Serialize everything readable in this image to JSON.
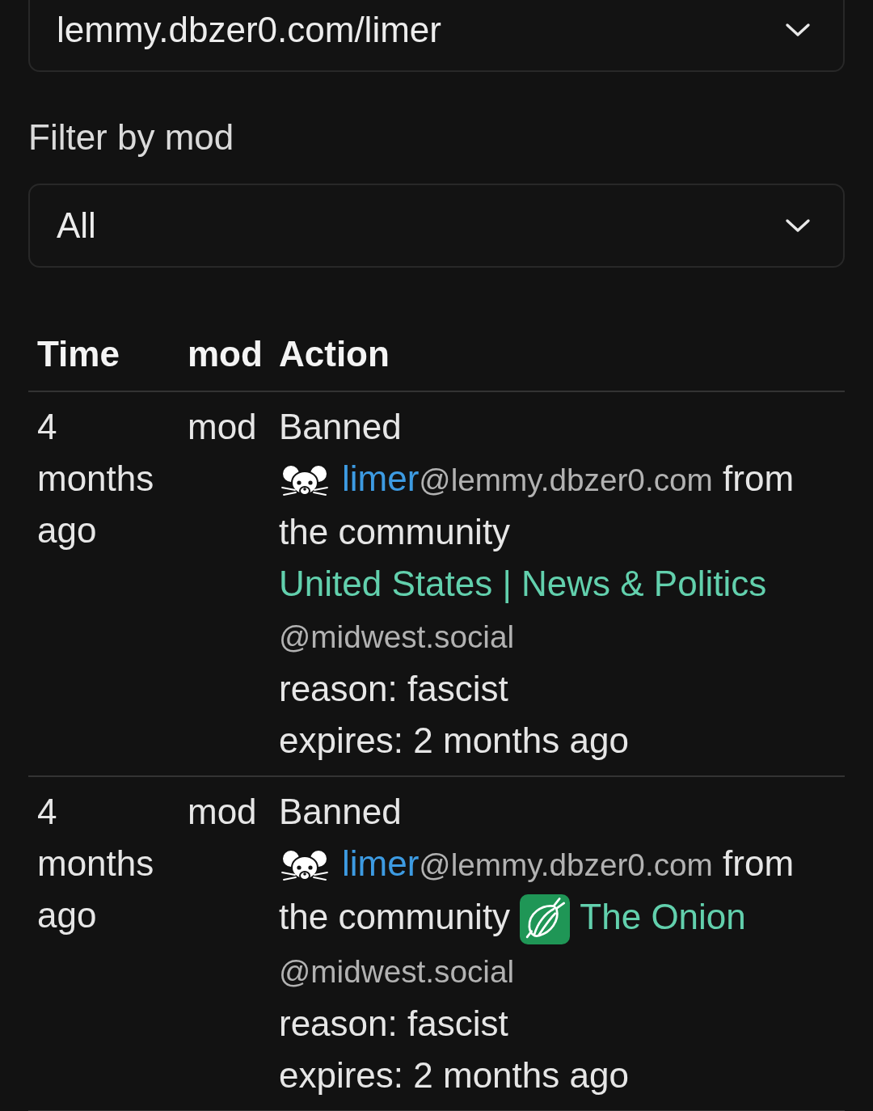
{
  "filters": [
    {
      "value": "lemmy.dbzer0.com/limer"
    },
    {
      "label": "Filter by mod",
      "value": "All"
    }
  ],
  "table": {
    "columns": [
      "Time",
      "mod",
      "Action"
    ],
    "rows": [
      {
        "time": "4 months ago",
        "mod": "mod",
        "action": "Banned",
        "user": {
          "name": "limer",
          "instance": "@lemmy.dbzer0.com"
        },
        "preposition": "from the community",
        "community": {
          "has_icon": false,
          "name": "United States | News & Politics",
          "instance": "@midwest.social"
        },
        "reason": "reason: fascist",
        "expires": "expires: 2 months ago"
      },
      {
        "time": "4 months ago",
        "mod": "mod",
        "action": "Banned",
        "user": {
          "name": "limer",
          "instance": "@lemmy.dbzer0.com"
        },
        "preposition": "from the community",
        "community": {
          "has_icon": true,
          "name": "The Onion",
          "instance": "@midwest.social"
        },
        "reason": "reason: fascist",
        "expires": "expires: 2 months ago"
      }
    ]
  }
}
